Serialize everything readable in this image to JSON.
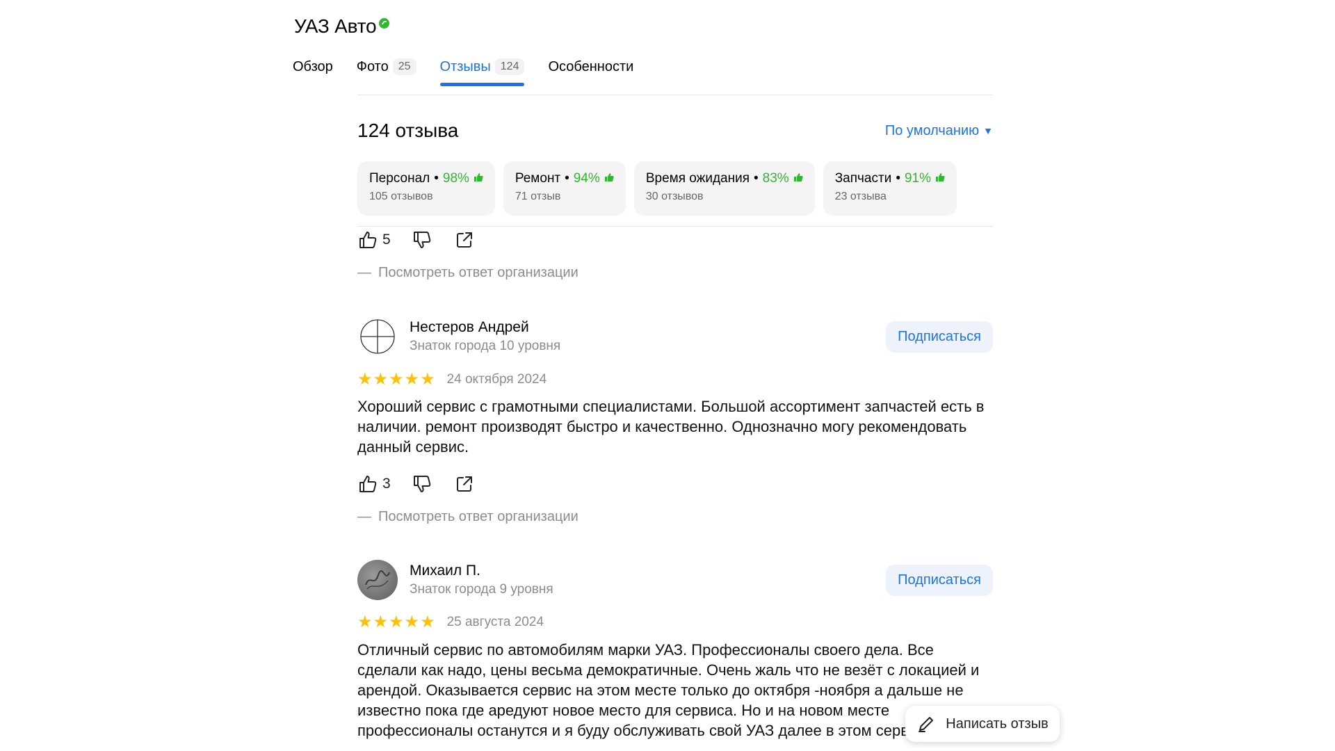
{
  "org": {
    "name": "УАЗ Авто"
  },
  "tabs": [
    {
      "label": "Обзор",
      "count": ""
    },
    {
      "label": "Фото",
      "count": "25"
    },
    {
      "label": "Отзывы",
      "count": "124"
    },
    {
      "label": "Особенности",
      "count": ""
    }
  ],
  "reviews_header": {
    "count_label": "124 отзыва",
    "sort_label": "По умолчанию"
  },
  "aspects": [
    {
      "name": "Персонал",
      "percent": "98%",
      "count": "105 отзывов"
    },
    {
      "name": "Ремонт",
      "percent": "94%",
      "count": "71 отзыв"
    },
    {
      "name": "Время ожидания",
      "percent": "83%",
      "count": "30 отзывов"
    },
    {
      "name": "Запчасти",
      "percent": "91%",
      "count": "23 отзыва"
    }
  ],
  "prev_review": {
    "likes": "5",
    "org_reply_label": "Посмотреть ответ организации"
  },
  "reviews": [
    {
      "author": "Нестеров Андрей",
      "level": "Знаток города 10 уровня",
      "subscribe_label": "Подписаться",
      "stars": 5,
      "date": "24 октября 2024",
      "text": "Хороший сервис с грамотными специалистами. Большой ассортимент запчастей есть в наличии. ремонт производят быстро и качественно. Однозначно могу рекомендовать данный сервис.",
      "likes": "3",
      "org_reply_label": "Посмотреть ответ организации"
    },
    {
      "author": "Михаил П.",
      "level": "Знаток города 9 уровня",
      "subscribe_label": "Подписаться",
      "stars": 5,
      "date": "25 августа 2024",
      "text": "Отличный сервис по автомобилям марки УАЗ. Профессионалы своего дела. Все сделали как надо, цены весьма демократичные. Очень жаль что не везёт с локацией и арендой. Оказывается сервис на этом месте только до октября -ноября а дальше не известно пока где аредуют новое место для сервиса. Но и на новом месте профессионалы останутся и я буду обслуживать свой УАЗ далее в этом сервисе."
    }
  ],
  "write_review": {
    "label": "Написать отзыв"
  },
  "icons": {
    "verified": "verified-check-icon",
    "like": "thumb-up-icon",
    "dislike": "thumb-down-icon",
    "share": "share-icon",
    "star": "star-icon",
    "pencil": "pencil-icon"
  },
  "colors": {
    "accent": "#1a73e8",
    "positive": "#2db82d",
    "star": "#ffc107"
  }
}
